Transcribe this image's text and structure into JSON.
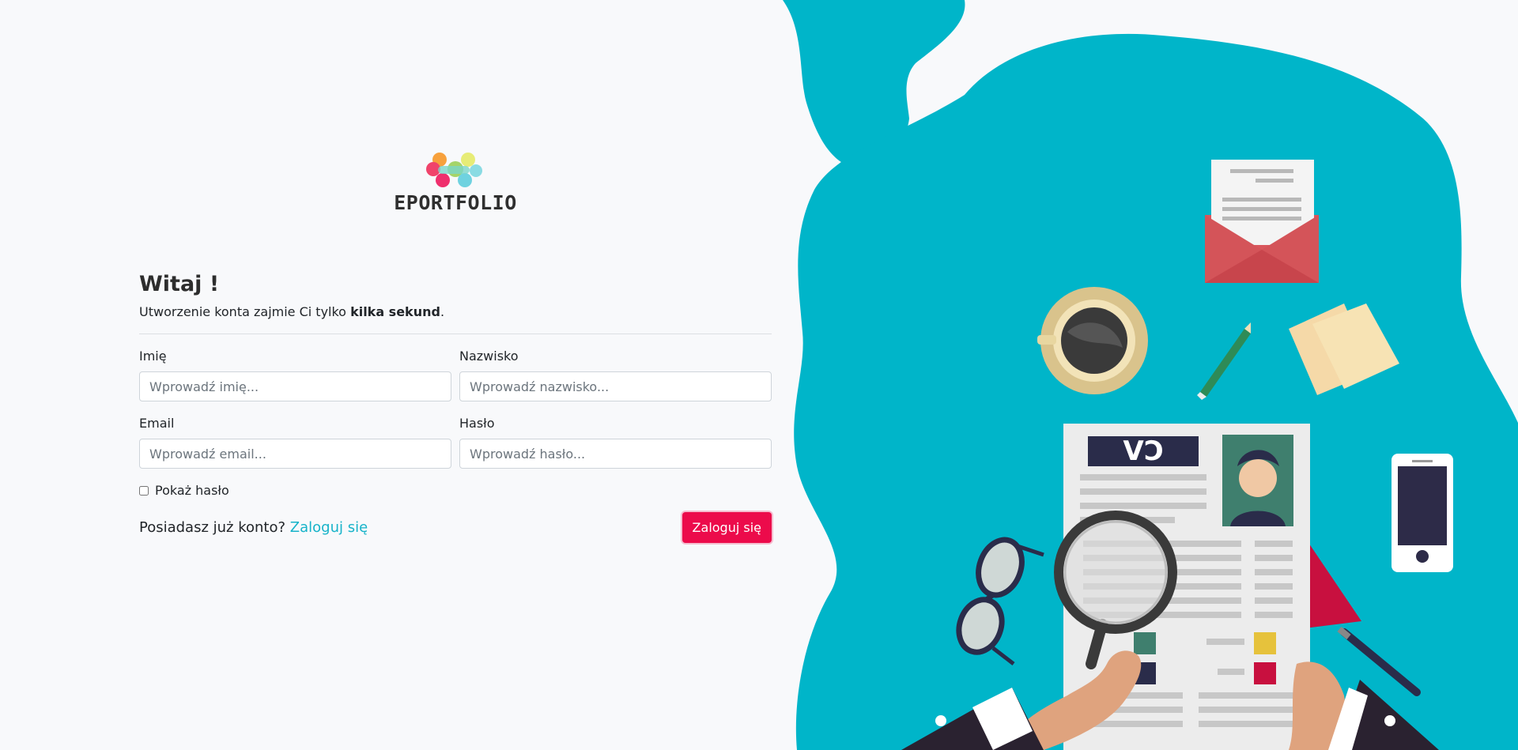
{
  "brand": {
    "name": "EPORTFOLIO"
  },
  "form": {
    "title": "Witaj !",
    "subtitle_pre": "Utworzenie konta zajmie Ci tylko ",
    "subtitle_bold": "kilka sekund",
    "subtitle_post": ".",
    "first_name": {
      "label": "Imię",
      "placeholder": "Wprowadź imię..."
    },
    "last_name": {
      "label": "Nazwisko",
      "placeholder": "Wprowadź nazwisko..."
    },
    "email": {
      "label": "Email",
      "placeholder": "Wprowadź email..."
    },
    "password": {
      "label": "Hasło",
      "placeholder": "Wprowadź hasło..."
    },
    "show_password_label": "Pokaż hasło",
    "have_account_text": "Posiadasz już konto?",
    "login_link": "Zaloguj się",
    "submit_label": "Zaloguj się"
  },
  "illustration": {
    "cv_label": "CV",
    "icons": [
      "envelope-icon",
      "coffee-cup-icon",
      "pencil-icon",
      "sticky-notes-icon",
      "smartphone-icon",
      "glasses-icon",
      "magnifier-icon",
      "pen-icon"
    ]
  },
  "colors": {
    "accent_teal": "#00b5c9",
    "button_red": "#ec0b4b",
    "background": "#f8f9fb"
  }
}
